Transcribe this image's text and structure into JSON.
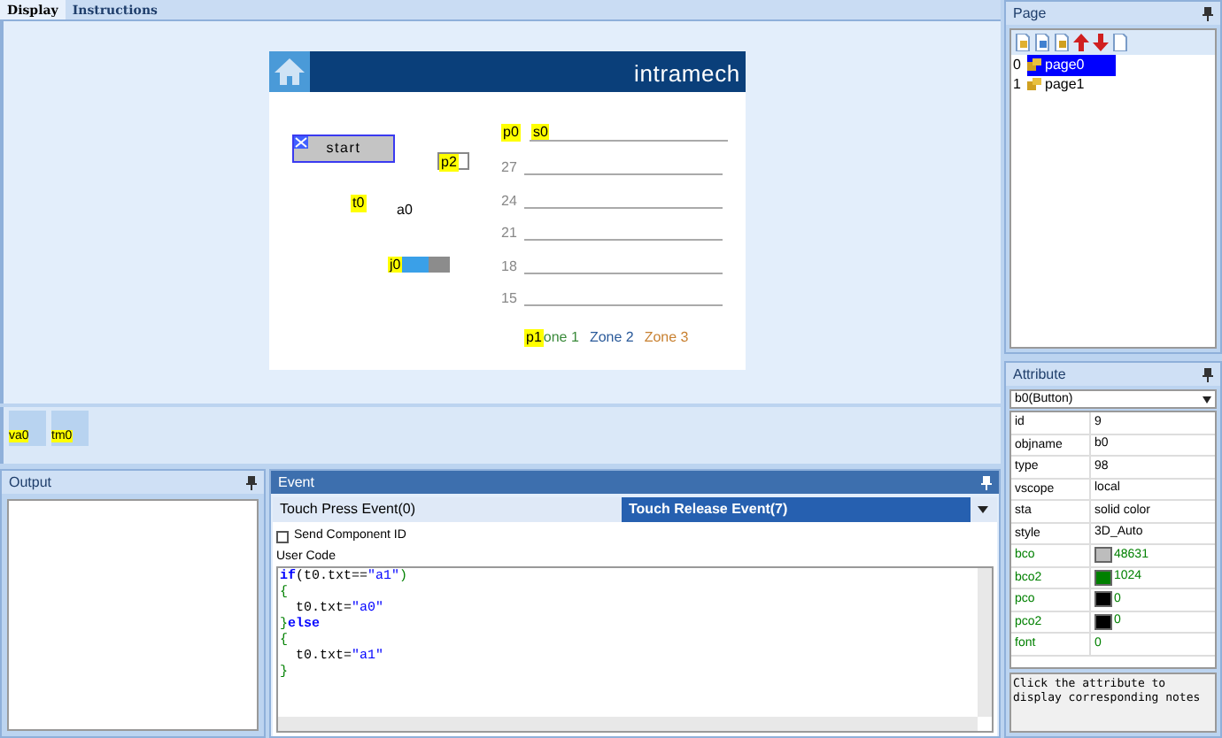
{
  "tabs": [
    {
      "label": "Display",
      "selected": true
    },
    {
      "label": "Instructions",
      "selected": false
    }
  ],
  "canvas": {
    "logo": "intramech",
    "start_button": {
      "label": "start"
    },
    "picture_tag": "p2",
    "text_tag": "t0",
    "text_value": "a0",
    "progress": {
      "tag": "j0",
      "level": 0.55
    },
    "chart": {
      "tags": [
        "p0",
        "s0"
      ],
      "ticks": [
        "27",
        "24",
        "21",
        "18",
        "15"
      ],
      "zones_tag": "p1",
      "zones": [
        {
          "label": "one 1",
          "color": "#3a8a3a"
        },
        {
          "label": "Zone 2",
          "color": "#2a5a9a"
        },
        {
          "label": "Zone 3",
          "color": "#c88030"
        }
      ]
    }
  },
  "timers": [
    "va0",
    "tm0"
  ],
  "output": {
    "title": "Output"
  },
  "event": {
    "title": "Event",
    "tabs": [
      {
        "label": "Touch Press Event(0)",
        "selected": false
      },
      {
        "label": "Touch Release Event(7)",
        "selected": true
      }
    ],
    "send_id": {
      "label": "Send Component ID",
      "checked": false
    },
    "user_code_label": "User Code",
    "code": [
      [
        {
          "kind": "keyword",
          "text": "if"
        },
        {
          "kind": "plain",
          "text": "(t0.txt=="
        },
        {
          "kind": "string",
          "text": "\"a1\""
        },
        {
          "kind": "brace",
          "text": ")"
        }
      ],
      [
        {
          "kind": "brace",
          "text": "{"
        }
      ],
      [
        {
          "kind": "plain",
          "text": "  t0.txt="
        },
        {
          "kind": "string",
          "text": "\"a0\""
        }
      ],
      [
        {
          "kind": "brace",
          "text": "}"
        },
        {
          "kind": "keyword",
          "text": "else"
        }
      ],
      [
        {
          "kind": "brace",
          "text": "{"
        }
      ],
      [
        {
          "kind": "plain",
          "text": "  t0.txt="
        },
        {
          "kind": "string",
          "text": "\"a1\""
        }
      ],
      [
        {
          "kind": "brace",
          "text": "}"
        }
      ]
    ]
  },
  "page_panel": {
    "title": "Page",
    "pages": [
      {
        "index": "0",
        "name": "page0",
        "selected": true
      },
      {
        "index": "1",
        "name": "page1",
        "selected": false
      }
    ]
  },
  "attribute": {
    "title": "Attribute",
    "selector": "b0(Button)",
    "rows": [
      {
        "name": "id",
        "value": "9",
        "editable": false
      },
      {
        "name": "objname",
        "value": "b0",
        "editable": false
      },
      {
        "name": "type",
        "value": "98",
        "editable": false
      },
      {
        "name": "vscope",
        "value": "local",
        "editable": false
      },
      {
        "name": "sta",
        "value": "solid color",
        "editable": false
      },
      {
        "name": "style",
        "value": "3D_Auto",
        "editable": false
      },
      {
        "name": "bco",
        "value": "48631",
        "editable": true,
        "color": "#bdbdbd"
      },
      {
        "name": "bco2",
        "value": "1024",
        "editable": true,
        "color": "#008000"
      },
      {
        "name": "pco",
        "value": "0",
        "editable": true,
        "color": "#000000"
      },
      {
        "name": "pco2",
        "value": "0",
        "editable": true,
        "color": "#000000"
      },
      {
        "name": "font",
        "value": "0",
        "editable": true
      }
    ],
    "notes": "Click the attribute to display corresponding notes"
  }
}
